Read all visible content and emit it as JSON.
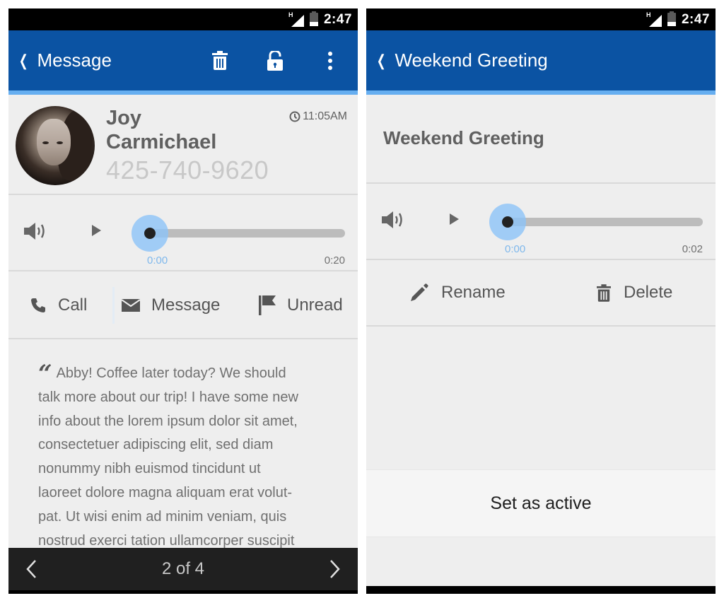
{
  "status_bar": {
    "network_label": "H",
    "time": "2:47"
  },
  "left_screen": {
    "header": {
      "back_label": "Message",
      "actions": [
        "trash-icon",
        "unlock-icon",
        "overflow-menu-icon"
      ]
    },
    "contact": {
      "first_name": "Joy",
      "last_name": "Carmichael",
      "phone": "425-740-9620",
      "timestamp": "11:05AM"
    },
    "player": {
      "current_time": "0:00",
      "duration": "0:20",
      "progress": 0
    },
    "actions": [
      {
        "label": "Call",
        "icon": "phone-icon"
      },
      {
        "label": "Message",
        "icon": "envelope-icon"
      },
      {
        "label": "Unread",
        "icon": "flag-icon"
      }
    ],
    "message_lines": [
      "Abby! Coffee later today? We should",
      "talk more about our trip! I have some new",
      "info about the lorem ipsum dolor sit amet,",
      "consectetuer adipiscing elit, sed diam",
      "nonummy nibh euismod tincidunt ut",
      "laoreet dolore magna aliquam erat volut-",
      "pat. Ut wisi enim ad minim veniam, quis",
      "nostrud exerci tation ullamcorper suscipit"
    ],
    "pager": {
      "label": "2 of 4",
      "current": 2,
      "total": 4
    }
  },
  "right_screen": {
    "header": {
      "back_label": "Weekend Greeting"
    },
    "greeting_title": "Weekend Greeting",
    "player": {
      "current_time": "0:00",
      "duration": "0:02",
      "progress": 0
    },
    "actions": [
      {
        "label": "Rename",
        "icon": "pencil-icon"
      },
      {
        "label": "Delete",
        "icon": "trash-icon"
      }
    ],
    "set_active_label": "Set as active"
  },
  "colors": {
    "header_blue": "#0b53a3",
    "accent_light_blue": "#66aef0",
    "slider_halo": "#8cc3f8",
    "time_start_blue": "#7fb8ec"
  }
}
